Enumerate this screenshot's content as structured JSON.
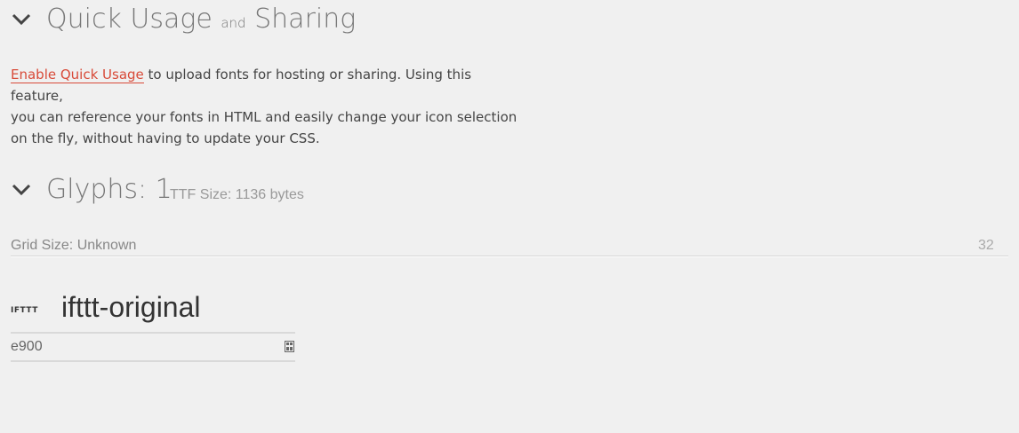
{
  "quick_usage": {
    "title_part1": "Quick Usage",
    "title_and": "and",
    "title_part2": "Sharing",
    "enable_link": "Enable Quick Usage",
    "line1_rest": " to upload fonts for hosting or sharing. Using this feature,",
    "line2": "you can reference your fonts in HTML and easily change your icon selection",
    "line3": "on the fly, without having to update your CSS."
  },
  "glyphs": {
    "title": "Glyphs: 1",
    "ttf_size": "TTF Size: 1136 bytes"
  },
  "grid": {
    "label": "Grid Size: Unknown",
    "value": "32"
  },
  "glyph_item": {
    "preview_text": "IFTTT",
    "name": "ifttt-original",
    "code": "e900"
  }
}
